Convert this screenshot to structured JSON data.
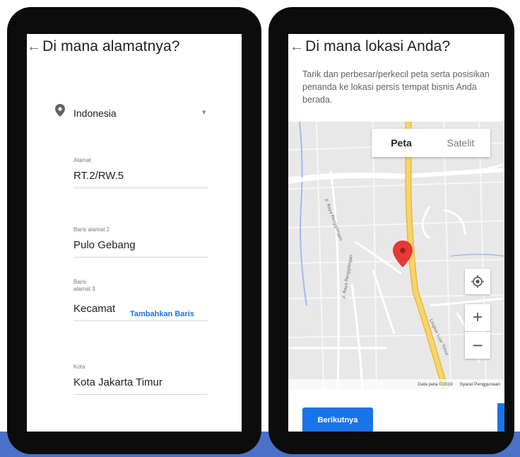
{
  "left_screen": {
    "title": "Di mana alamatnya?",
    "back_icon": "arrow-left-icon",
    "country": {
      "icon": "location-pin-icon",
      "value": "Indonesia"
    },
    "fields": {
      "alamat": {
        "label": "Alamat",
        "value": "RT.2/RW.5"
      },
      "baris2": {
        "label": "Baris alamat 2",
        "value": "Pulo Gebang"
      },
      "baris3": {
        "label_line1": "Baris",
        "label_line2": "alamat 3",
        "value": "Kecamat"
      },
      "kota": {
        "label": "Kota",
        "value": "Kota Jakarta Timur"
      }
    },
    "add_line_label": "Tambahkan Baris"
  },
  "right_screen": {
    "title": "Di mana lokasi Anda?",
    "back_icon": "arrow-left-icon",
    "description": "Tarik dan perbesar/perkecil peta serta posisikan penanda ke lokasi persis tempat bisnis Anda berada.",
    "map": {
      "toggle_map": "Peta",
      "toggle_satellite": "Satelit",
      "footer_data": "Data peta ©2019",
      "footer_terms": "Syarat Penggunaan",
      "zoom_in": "+",
      "zoom_out": "−"
    },
    "next_button": "Berikutnya"
  },
  "colors": {
    "accent": "#1a73e8",
    "marker": "#e53935",
    "road_major": "#f6d56b",
    "bottom_strip": "#4a72c9"
  }
}
